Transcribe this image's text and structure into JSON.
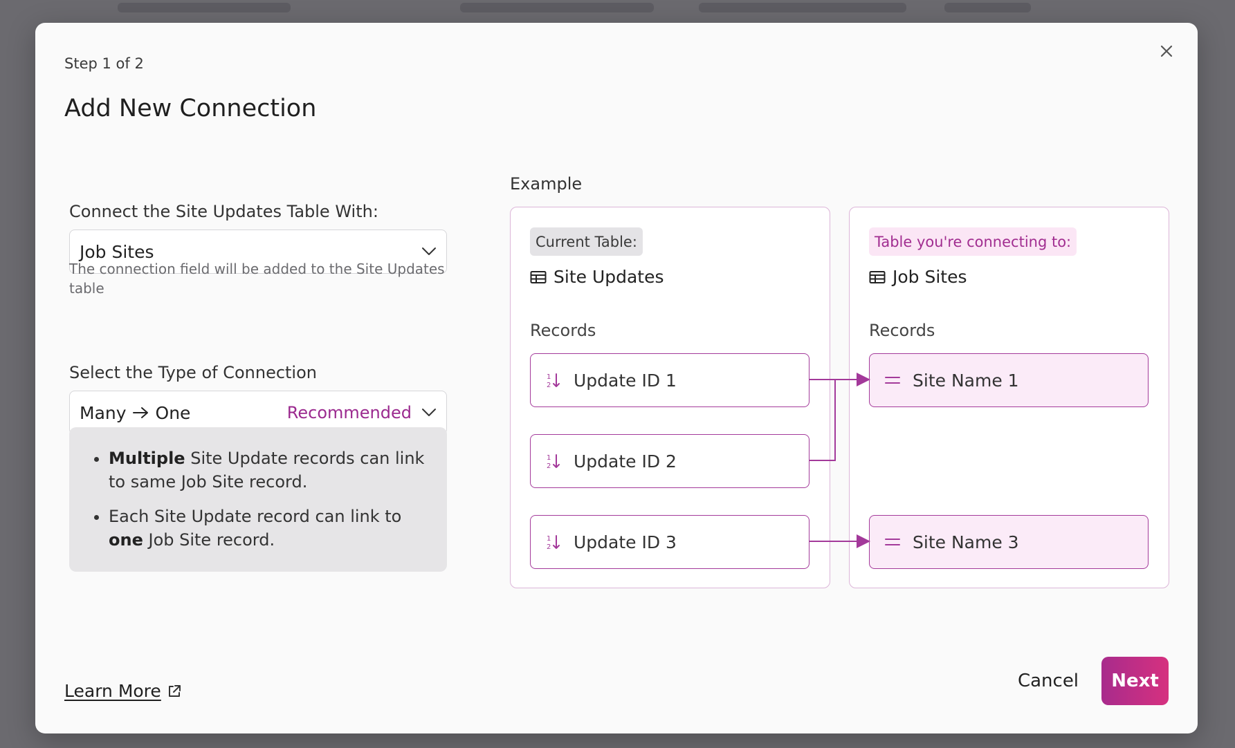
{
  "modal": {
    "step": "Step 1 of 2",
    "title": "Add New Connection"
  },
  "form": {
    "connect_label": "Connect the Site Updates Table With:",
    "connect_value": "Job Sites",
    "connect_hint": "The connection field will be added to the Site Updates table",
    "type_label": "Select the Type of Connection",
    "type_from": "Many",
    "type_to": "One",
    "type_badge": "Recommended"
  },
  "info": {
    "line1_bold": "Multiple",
    "line1_rest": " Site Update records can link to same Job Site record.",
    "line2_start": "Each Site Update record can link to ",
    "line2_bold": "one",
    "line2_end": " Job Site record."
  },
  "example": {
    "label": "Example",
    "current": {
      "chip": "Current Table:",
      "table_name": "Site Updates",
      "records_label": "Records",
      "records": [
        "Update ID 1",
        "Update ID 2",
        "Update ID 3"
      ]
    },
    "target": {
      "chip": "Table you're connecting to:",
      "table_name": "Job Sites",
      "records_label": "Records",
      "records": [
        "Site Name 1",
        "Site Name 3"
      ]
    }
  },
  "footer": {
    "learn_more": "Learn More",
    "cancel": "Cancel",
    "next": "Next"
  },
  "colors": {
    "accent": "#a3399a",
    "accent_light": "#fbebf8",
    "next_gradient_start": "#a82b8c",
    "next_gradient_end": "#d6317f"
  }
}
